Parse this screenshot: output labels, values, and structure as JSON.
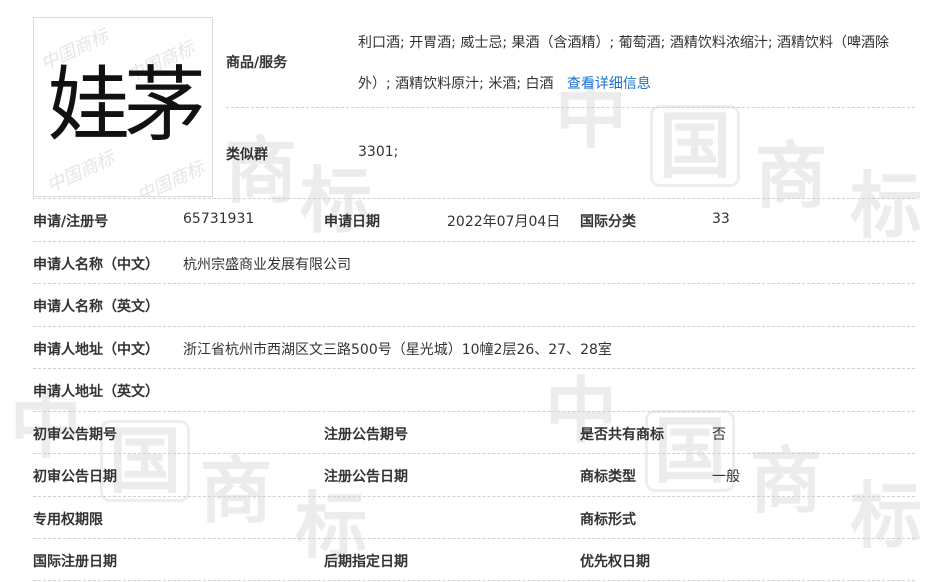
{
  "trademark": {
    "name": "娃茅",
    "image_watermark": "中国商标"
  },
  "goods_services": {
    "label": "商品/服务",
    "line1": "利口酒; 开胃酒; 威士忌; 果酒（含酒精）; 葡萄酒; 酒精饮料浓缩汁; 酒精饮料（啤酒除",
    "line2": "外）; 酒精饮料原汁; 米酒; 白酒",
    "detail_link": "查看详细信息"
  },
  "similar_group": {
    "label": "类似群",
    "value": "3301;"
  },
  "registration_no": {
    "label": "申请/注册号",
    "value": "65731931"
  },
  "application_date": {
    "label": "申请日期",
    "value": "2022年07月04日"
  },
  "intl_class": {
    "label": "国际分类",
    "value": "33"
  },
  "applicant_name_cn": {
    "label": "申请人名称（中文）",
    "value": "杭州宗盛商业发展有限公司"
  },
  "applicant_name_en": {
    "label": "申请人名称（英文）",
    "value": ""
  },
  "applicant_addr_cn": {
    "label": "申请人地址（中文）",
    "value": "浙江省杭州市西湖区文三路500号（星光城）10幢2层26、27、28室"
  },
  "applicant_addr_en": {
    "label": "申请人地址（英文）",
    "value": ""
  },
  "prelim_pub_no": {
    "label": "初审公告期号",
    "value": ""
  },
  "reg_pub_no": {
    "label": "注册公告期号",
    "value": ""
  },
  "shared_trademark": {
    "label": "是否共有商标",
    "value": "否"
  },
  "prelim_pub_date": {
    "label": "初审公告日期",
    "value": ""
  },
  "reg_pub_date": {
    "label": "注册公告日期",
    "value": ""
  },
  "trademark_type": {
    "label": "商标类型",
    "value": "一般"
  },
  "exclusive_period": {
    "label": "专用权期限",
    "value": ""
  },
  "trademark_form": {
    "label": "商标形式",
    "value": ""
  },
  "intl_reg_date": {
    "label": "国际注册日期",
    "value": ""
  },
  "later_designation_date": {
    "label": "后期指定日期",
    "value": ""
  },
  "priority_date": {
    "label": "优先权日期",
    "value": ""
  },
  "page_watermark": [
    "中",
    "国",
    "商",
    "标"
  ]
}
